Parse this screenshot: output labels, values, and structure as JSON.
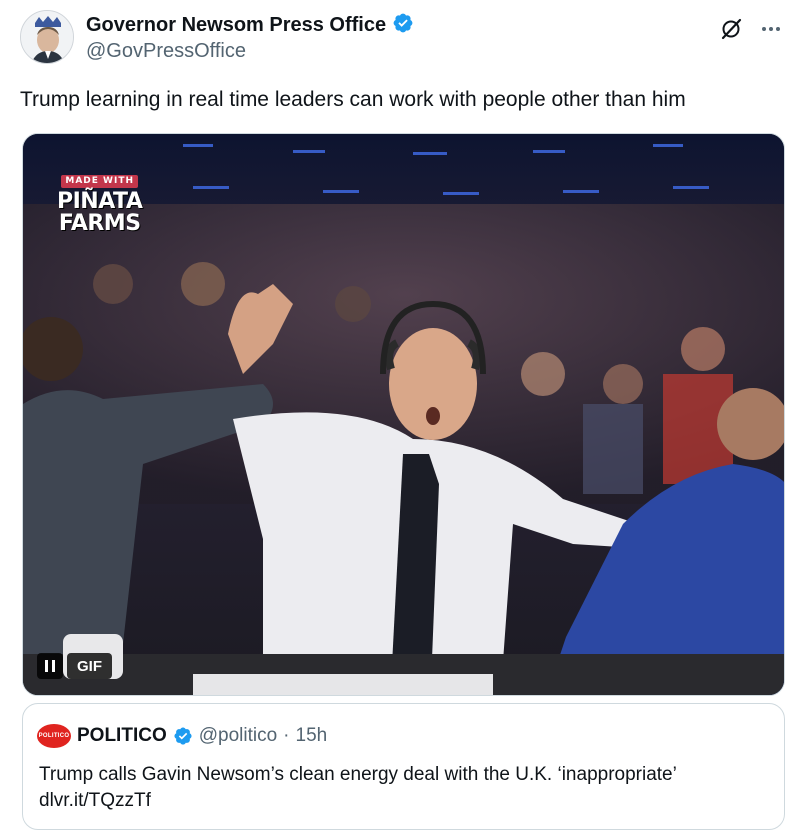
{
  "author": {
    "display_name": "Governor Newsom Press Office",
    "handle": "@GovPressOffice",
    "verified_color": "#1d9bf0"
  },
  "tweet": {
    "text": "Trump learning in real time leaders can work with people other than him"
  },
  "media": {
    "watermark_top": "MADE WITH",
    "watermark_line1": "PIÑATA",
    "watermark_line2": "FARMS",
    "badge": "GIF"
  },
  "quote": {
    "avatar_text": "POLITICO",
    "display_name": "POLITICO",
    "handle": "@politico",
    "separator": "·",
    "time": "15h",
    "text_line1": "Trump calls Gavin Newsom’s clean energy deal with the U.K. ‘inappropriate’",
    "text_line2": "dlvr.it/TQzzTf",
    "brand_color": "#e0241f"
  },
  "icons": {
    "grok": "grok-icon",
    "more": "more-icon",
    "verified": "verified-badge-icon",
    "pause": "pause-icon"
  }
}
